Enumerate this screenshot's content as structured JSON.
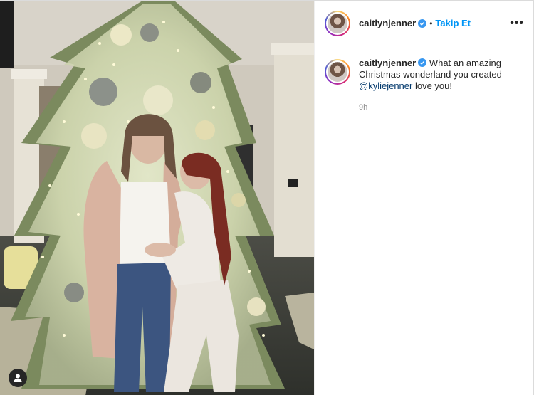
{
  "header": {
    "username": "caitlynjenner",
    "separator": "•",
    "follow_label": "Takip Et",
    "more_label": "•••"
  },
  "caption": {
    "username": "caitlynjenner",
    "text_before": "What an amazing Christmas wonderland you created ",
    "mention": "@kyliejenner",
    "text_after": " love you!",
    "time": "9h"
  },
  "icons": {
    "verified": "verified-badge-icon",
    "tag": "user-tag-icon"
  },
  "colors": {
    "link": "#0095f6",
    "mention": "#00376b",
    "verified": "#3897f0"
  }
}
